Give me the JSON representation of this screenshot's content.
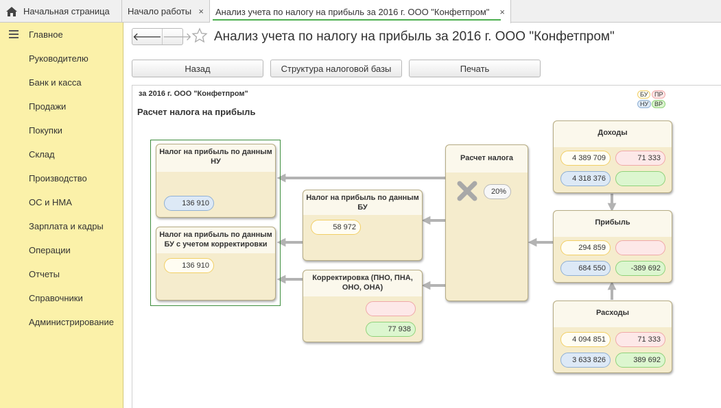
{
  "tabs": {
    "home": "Начальная страница",
    "tab1": "Начало работы",
    "tab2": "Анализ учета по налогу на прибыль за 2016 г. ООО \"Конфетпром\"",
    "close": "×"
  },
  "sidebar": {
    "items": [
      "Главное",
      "Руководителю",
      "Банк и касса",
      "Продажи",
      "Покупки",
      "Склад",
      "Производство",
      "ОС и НМА",
      "Зарплата и кадры",
      "Операции",
      "Отчеты",
      "Справочники",
      "Администрирование"
    ]
  },
  "header": {
    "title": "Анализ учета по налогу на прибыль за 2016 г. ООО \"Конфетпром\"",
    "back_arrow": "🡐",
    "forward_arrow": "🡒"
  },
  "toolbar": {
    "back_label": "Назад",
    "structure_label": "Структура налоговой базы",
    "print_label": "Печать"
  },
  "report": {
    "org_line": "за 2016 г. ООО \"Конфетпром\"",
    "title": "Расчет налога на прибыль",
    "legend": {
      "bu": "БУ",
      "pr": "ПР",
      "nu": "НУ",
      "vr": "ВР"
    },
    "cards": {
      "tax_nu": {
        "title": "Налог на прибыль по данным НУ",
        "nu": "136 910"
      },
      "tax_bu_corr": {
        "title": "Налог на прибыль по данным БУ с учетом корректировки",
        "bu": "136 910"
      },
      "tax_bu": {
        "title": "Налог на прибыль по данным БУ",
        "bu": "58 972"
      },
      "correction": {
        "title": "Корректировка (ПНО, ПНА, ОНО, ОНА)",
        "pr": "",
        "vr": "77 938"
      },
      "calc": {
        "title": "Расчет налога",
        "rate": "20%"
      },
      "income": {
        "title": "Доходы",
        "bu": "4 389 709",
        "pr": "71 333",
        "nu": "4 318 376",
        "vr": ""
      },
      "profit": {
        "title": "Прибыль",
        "bu": "294 859",
        "pr": "",
        "nu": "684 550",
        "vr": "-389 692"
      },
      "expenses": {
        "title": "Расходы",
        "bu": "4 094 851",
        "pr": "71 333",
        "nu": "3 633 826",
        "vr": "389 692"
      }
    }
  },
  "colors": {
    "sidebar_bg": "#fbf1a9",
    "active_tab_underline": "#4caf50",
    "frame_green": "#3c8c3c",
    "arrow_gray": "#b3b3b3"
  }
}
